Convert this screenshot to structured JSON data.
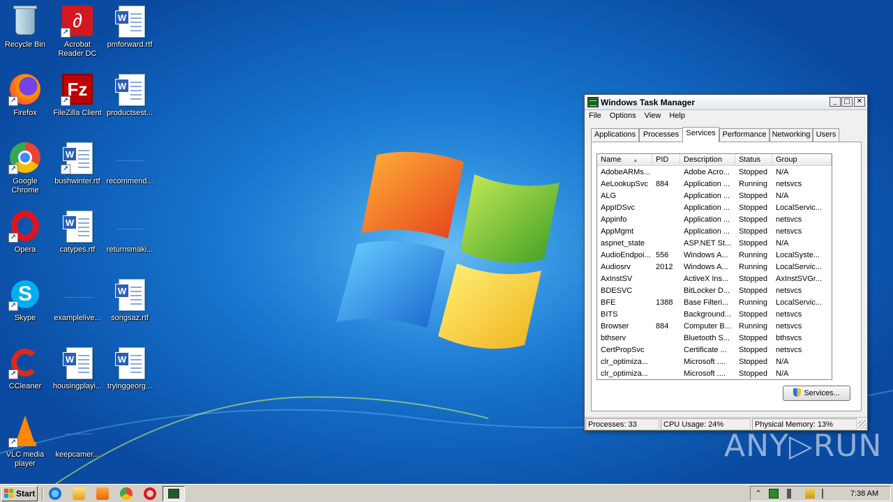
{
  "desktop": {
    "icons": [
      {
        "label": "Recycle Bin",
        "icon": "recycle-bin-icon"
      },
      {
        "label": "Acrobat Reader DC",
        "icon": "acrobat-reader-icon"
      },
      {
        "label": "pmforward.rtf",
        "icon": "word-document-icon"
      },
      {
        "label": "Firefox",
        "icon": "firefox-icon"
      },
      {
        "label": "FileZilla Client",
        "icon": "filezilla-icon"
      },
      {
        "label": "productsest...",
        "icon": "word-document-icon"
      },
      {
        "label": "Google Chrome",
        "icon": "chrome-icon"
      },
      {
        "label": "bushwinter.rtf",
        "icon": "word-document-icon"
      },
      {
        "label": "recommend...",
        "icon": "blank-file-icon"
      },
      {
        "label": "Opera",
        "icon": "opera-icon"
      },
      {
        "label": "catypes.rtf",
        "icon": "word-document-icon"
      },
      {
        "label": "returnsmaki...",
        "icon": "blank-file-icon"
      },
      {
        "label": "Skype",
        "icon": "skype-icon"
      },
      {
        "label": "examplelive...",
        "icon": "blank-file-icon"
      },
      {
        "label": "songsaz.rtf",
        "icon": "word-document-icon"
      },
      {
        "label": "CCleaner",
        "icon": "ccleaner-icon"
      },
      {
        "label": "housingplayi...",
        "icon": "word-document-icon"
      },
      {
        "label": "tryinggeorg...",
        "icon": "word-document-icon"
      },
      {
        "label": "VLC media player",
        "icon": "vlc-icon"
      },
      {
        "label": "keepcamer...",
        "icon": "blank-file-icon"
      }
    ]
  },
  "taskmgr": {
    "title": "Windows Task Manager",
    "caption_buttons": {
      "minimize": "_",
      "maximize": "□",
      "close": "✕"
    },
    "menu": [
      "File",
      "Options",
      "View",
      "Help"
    ],
    "tabs": [
      "Applications",
      "Processes",
      "Services",
      "Performance",
      "Networking",
      "Users"
    ],
    "active_tab": "Services",
    "columns": [
      "Name",
      "PID",
      "Description",
      "Status",
      "Group"
    ],
    "sort_indicator": "▲",
    "rows": [
      {
        "name": "AdobeARMs...",
        "pid": "",
        "description": "Adobe Acro...",
        "status": "Stopped",
        "group": "N/A"
      },
      {
        "name": "AeLookupSvc",
        "pid": "884",
        "description": "Application ...",
        "status": "Running",
        "group": "netsvcs"
      },
      {
        "name": "ALG",
        "pid": "",
        "description": "Application ...",
        "status": "Stopped",
        "group": "N/A"
      },
      {
        "name": "AppIDSvc",
        "pid": "",
        "description": "Application ...",
        "status": "Stopped",
        "group": "LocalServic..."
      },
      {
        "name": "Appinfo",
        "pid": "",
        "description": "Application ...",
        "status": "Stopped",
        "group": "netsvcs"
      },
      {
        "name": "AppMgmt",
        "pid": "",
        "description": "Application ...",
        "status": "Stopped",
        "group": "netsvcs"
      },
      {
        "name": "aspnet_state",
        "pid": "",
        "description": "ASP.NET St...",
        "status": "Stopped",
        "group": "N/A"
      },
      {
        "name": "AudioEndpoi...",
        "pid": "556",
        "description": "Windows A...",
        "status": "Running",
        "group": "LocalSyste..."
      },
      {
        "name": "Audiosrv",
        "pid": "2012",
        "description": "Windows A...",
        "status": "Running",
        "group": "LocalServic..."
      },
      {
        "name": "AxInstSV",
        "pid": "",
        "description": "ActiveX Ins...",
        "status": "Stopped",
        "group": "AxInstSVGr..."
      },
      {
        "name": "BDESVC",
        "pid": "",
        "description": "BitLocker D...",
        "status": "Stopped",
        "group": "netsvcs"
      },
      {
        "name": "BFE",
        "pid": "1388",
        "description": "Base Filteri...",
        "status": "Running",
        "group": "LocalServic..."
      },
      {
        "name": "BITS",
        "pid": "",
        "description": "Background...",
        "status": "Stopped",
        "group": "netsvcs"
      },
      {
        "name": "Browser",
        "pid": "884",
        "description": "Computer B...",
        "status": "Running",
        "group": "netsvcs"
      },
      {
        "name": "bthserv",
        "pid": "",
        "description": "Bluetooth S...",
        "status": "Stopped",
        "group": "bthsvcs"
      },
      {
        "name": "CertPropSvc",
        "pid": "",
        "description": "Certificate ...",
        "status": "Stopped",
        "group": "netsvcs"
      },
      {
        "name": "clr_optimiza...",
        "pid": "",
        "description": "Microsoft ....",
        "status": "Stopped",
        "group": "N/A"
      },
      {
        "name": "clr_optimiza...",
        "pid": "",
        "description": "Microsoft ....",
        "status": "Stopped",
        "group": "N/A"
      }
    ],
    "services_button": "Services...",
    "status_bar": {
      "processes": "Processes: 33",
      "cpu": "CPU Usage: 24%",
      "memory": "Physical Memory: 13%"
    }
  },
  "taskbar": {
    "start_label": "Start",
    "pinned": [
      "internet-explorer-icon",
      "file-explorer-icon",
      "media-player-icon",
      "chrome-icon",
      "opera-icon"
    ],
    "active_task": "task-manager-icon",
    "tray_icons": [
      "show-hidden-icons",
      "network-icon",
      "volume-icon",
      "power-icon",
      "action-center-flag-icon"
    ],
    "tray_chevron": "⌃",
    "clock": "7:38 AM"
  },
  "watermark": "ANY▷RUN",
  "colors": {
    "desktop_bg": "#1a7bd3",
    "taskbar_bg": "#d4d0c8",
    "window_bg": "#f0f0f0"
  }
}
